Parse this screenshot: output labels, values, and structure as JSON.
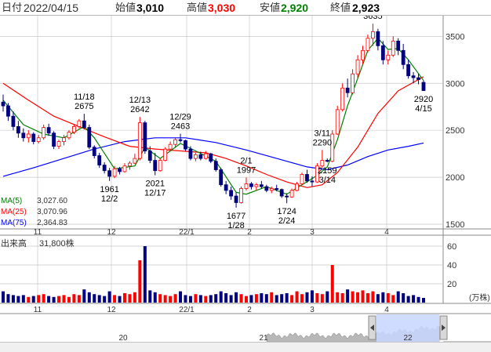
{
  "header": {
    "date_label": "日付",
    "date_value": "2022/04/15",
    "open_label": "始値",
    "open_value": "3,010",
    "high_label": "高値",
    "high_value": "3,030",
    "low_label": "安値",
    "low_value": "2,920",
    "close_label": "終値",
    "close_value": "2,923"
  },
  "colors": {
    "up_candle": "#ff0000",
    "down_candle": "#000080",
    "ma5": "#008000",
    "ma25": "#ff0000",
    "ma75": "#0000ff",
    "volume_up": "#ff0000",
    "volume_down": "#000080",
    "high_value_text": "#ff0000",
    "low_value_text": "#008000",
    "grid": "#c8c8c8",
    "navigator_fill": "#b8b8b8",
    "navigator_window": "#c8d6ff"
  },
  "chart_data": {
    "type": "candlestick",
    "price_axis": {
      "ticks": [
        "1500",
        "2000",
        "2500",
        "3000",
        "3500"
      ],
      "ylim": [
        1450,
        3720
      ]
    },
    "x_axis": {
      "month_labels": [
        "11",
        "12",
        "22/1",
        "2",
        "3",
        "4"
      ]
    },
    "ma_legend": [
      {
        "name": "MA(5)",
        "value": "3,027.60"
      },
      {
        "name": "MA(25)",
        "value": "3,070.96"
      },
      {
        "name": "MA(75)",
        "value": "2,364.83"
      }
    ],
    "annotations": [
      {
        "date": "11/18",
        "value": "2675",
        "position": "above"
      },
      {
        "date": "12/2",
        "value": "1961",
        "position": "below"
      },
      {
        "date": "12/13",
        "value": "2642",
        "position": "above"
      },
      {
        "date": "12/17",
        "value": "2021",
        "position": "below"
      },
      {
        "date": "12/29",
        "value": "2463",
        "position": "above"
      },
      {
        "date": "1/28",
        "value": "1677",
        "position": "below"
      },
      {
        "date": "2/1",
        "value": "1997",
        "position": "above"
      },
      {
        "date": "2/24",
        "value": "1724",
        "position": "below"
      },
      {
        "date": "3/11",
        "value": "2290",
        "position": "above"
      },
      {
        "date": "3/14",
        "value": "2159",
        "position": "below"
      },
      {
        "date": "3/30",
        "value": "3635",
        "position": "above"
      },
      {
        "date": "4/15",
        "value": "2920",
        "position": "below"
      }
    ],
    "candles": [
      {
        "open": 2800,
        "high": 2880,
        "low": 2700,
        "close": 2760
      },
      {
        "open": 2760,
        "high": 2790,
        "low": 2600,
        "close": 2650
      },
      {
        "open": 2650,
        "high": 2700,
        "low": 2500,
        "close": 2540
      },
      {
        "open": 2540,
        "high": 2600,
        "low": 2420,
        "close": 2470
      },
      {
        "open": 2470,
        "high": 2520,
        "low": 2380,
        "close": 2420
      },
      {
        "open": 2420,
        "high": 2500,
        "low": 2370,
        "close": 2460
      },
      {
        "open": 2460,
        "high": 2480,
        "low": 2350,
        "close": 2380
      },
      {
        "open": 2380,
        "high": 2450,
        "low": 2360,
        "close": 2420
      },
      {
        "open": 2420,
        "high": 2560,
        "low": 2400,
        "close": 2530
      },
      {
        "open": 2530,
        "high": 2570,
        "low": 2440,
        "close": 2470
      },
      {
        "open": 2470,
        "high": 2490,
        "low": 2300,
        "close": 2330
      },
      {
        "open": 2330,
        "high": 2400,
        "low": 2300,
        "close": 2380
      },
      {
        "open": 2380,
        "high": 2450,
        "low": 2340,
        "close": 2420
      },
      {
        "open": 2420,
        "high": 2500,
        "low": 2400,
        "close": 2480
      },
      {
        "open": 2480,
        "high": 2560,
        "low": 2460,
        "close": 2540
      },
      {
        "open": 2540,
        "high": 2620,
        "low": 2520,
        "close": 2600
      },
      {
        "open": 2600,
        "high": 2675,
        "low": 2510,
        "close": 2530
      },
      {
        "open": 2530,
        "high": 2560,
        "low": 2300,
        "close": 2320
      },
      {
        "open": 2320,
        "high": 2340,
        "low": 2200,
        "close": 2230
      },
      {
        "open": 2230,
        "high": 2260,
        "low": 2100,
        "close": 2130
      },
      {
        "open": 2130,
        "high": 2160,
        "low": 2040,
        "close": 2070
      },
      {
        "open": 2070,
        "high": 2100,
        "low": 1961,
        "close": 2010
      },
      {
        "open": 2010,
        "high": 2120,
        "low": 1990,
        "close": 2090
      },
      {
        "open": 2090,
        "high": 2110,
        "low": 2030,
        "close": 2060
      },
      {
        "open": 2060,
        "high": 2150,
        "low": 2050,
        "close": 2120
      },
      {
        "open": 2120,
        "high": 2170,
        "low": 2080,
        "close": 2150
      },
      {
        "open": 2150,
        "high": 2250,
        "low": 2140,
        "close": 2200
      },
      {
        "open": 2200,
        "high": 2642,
        "low": 2180,
        "close": 2580
      },
      {
        "open": 2580,
        "high": 2600,
        "low": 2250,
        "close": 2280
      },
      {
        "open": 2280,
        "high": 2330,
        "low": 2150,
        "close": 2180
      },
      {
        "open": 2180,
        "high": 2260,
        "low": 2021,
        "close": 2070
      },
      {
        "open": 2070,
        "high": 2200,
        "low": 2060,
        "close": 2180
      },
      {
        "open": 2180,
        "high": 2320,
        "low": 2170,
        "close": 2300
      },
      {
        "open": 2300,
        "high": 2380,
        "low": 2280,
        "close": 2350
      },
      {
        "open": 2350,
        "high": 2420,
        "low": 2320,
        "close": 2400
      },
      {
        "open": 2400,
        "high": 2463,
        "low": 2370,
        "close": 2390
      },
      {
        "open": 2390,
        "high": 2400,
        "low": 2280,
        "close": 2300
      },
      {
        "open": 2300,
        "high": 2330,
        "low": 2180,
        "close": 2200
      },
      {
        "open": 2200,
        "high": 2260,
        "low": 2170,
        "close": 2240
      },
      {
        "open": 2240,
        "high": 2270,
        "low": 2180,
        "close": 2200
      },
      {
        "open": 2200,
        "high": 2280,
        "low": 2190,
        "close": 2250
      },
      {
        "open": 2250,
        "high": 2260,
        "low": 2150,
        "close": 2170
      },
      {
        "open": 2170,
        "high": 2200,
        "low": 2060,
        "close": 2080
      },
      {
        "open": 2080,
        "high": 2100,
        "low": 1900,
        "close": 1920
      },
      {
        "open": 1920,
        "high": 1960,
        "low": 1820,
        "close": 1860
      },
      {
        "open": 1860,
        "high": 1900,
        "low": 1760,
        "close": 1800
      },
      {
        "open": 1800,
        "high": 1840,
        "low": 1677,
        "close": 1730
      },
      {
        "open": 1730,
        "high": 1900,
        "low": 1720,
        "close": 1880
      },
      {
        "open": 1880,
        "high": 1997,
        "low": 1860,
        "close": 1930
      },
      {
        "open": 1930,
        "high": 1950,
        "low": 1870,
        "close": 1900
      },
      {
        "open": 1900,
        "high": 1940,
        "low": 1860,
        "close": 1920
      },
      {
        "open": 1920,
        "high": 1960,
        "low": 1880,
        "close": 1900
      },
      {
        "open": 1900,
        "high": 1920,
        "low": 1840,
        "close": 1860
      },
      {
        "open": 1860,
        "high": 1900,
        "low": 1830,
        "close": 1880
      },
      {
        "open": 1880,
        "high": 1920,
        "low": 1850,
        "close": 1870
      },
      {
        "open": 1870,
        "high": 1880,
        "low": 1780,
        "close": 1800
      },
      {
        "open": 1800,
        "high": 1830,
        "low": 1724,
        "close": 1790
      },
      {
        "open": 1790,
        "high": 1880,
        "low": 1780,
        "close": 1860
      },
      {
        "open": 1860,
        "high": 1950,
        "low": 1850,
        "close": 1930
      },
      {
        "open": 1930,
        "high": 2050,
        "low": 1920,
        "close": 2030
      },
      {
        "open": 2030,
        "high": 2080,
        "low": 1940,
        "close": 1960
      },
      {
        "open": 1960,
        "high": 2010,
        "low": 1900,
        "close": 1950
      },
      {
        "open": 1950,
        "high": 2150,
        "low": 1940,
        "close": 2120
      },
      {
        "open": 2120,
        "high": 2290,
        "low": 2100,
        "close": 2180
      },
      {
        "open": 2180,
        "high": 2200,
        "low": 2159,
        "close": 2170
      },
      {
        "open": 2170,
        "high": 2500,
        "low": 2160,
        "close": 2460
      },
      {
        "open": 2460,
        "high": 2760,
        "low": 2450,
        "close": 2720
      },
      {
        "open": 2720,
        "high": 3000,
        "low": 2700,
        "close": 2950
      },
      {
        "open": 2950,
        "high": 3050,
        "low": 2850,
        "close": 2900
      },
      {
        "open": 2900,
        "high": 3150,
        "low": 2880,
        "close": 3100
      },
      {
        "open": 3100,
        "high": 3300,
        "low": 3060,
        "close": 3250
      },
      {
        "open": 3250,
        "high": 3400,
        "low": 3200,
        "close": 3350
      },
      {
        "open": 3350,
        "high": 3520,
        "low": 3330,
        "close": 3480
      },
      {
        "open": 3480,
        "high": 3635,
        "low": 3400,
        "close": 3550
      },
      {
        "open": 3550,
        "high": 3580,
        "low": 3350,
        "close": 3400
      },
      {
        "open": 3400,
        "high": 3450,
        "low": 3200,
        "close": 3250
      },
      {
        "open": 3250,
        "high": 3350,
        "low": 3200,
        "close": 3300
      },
      {
        "open": 3300,
        "high": 3500,
        "low": 3280,
        "close": 3450
      },
      {
        "open": 3450,
        "high": 3480,
        "low": 3300,
        "close": 3350
      },
      {
        "open": 3350,
        "high": 3420,
        "low": 3150,
        "close": 3200
      },
      {
        "open": 3200,
        "high": 3250,
        "low": 3050,
        "close": 3080
      },
      {
        "open": 3080,
        "high": 3120,
        "low": 3000,
        "close": 3060
      },
      {
        "open": 3060,
        "high": 3100,
        "low": 2990,
        "close": 3040
      },
      {
        "open": 3010,
        "high": 3030,
        "low": 2920,
        "close": 2923
      }
    ],
    "ma5": [
      {
        "i": 0,
        "v": 2820
      },
      {
        "i": 4,
        "v": 2560
      },
      {
        "i": 8,
        "v": 2460
      },
      {
        "i": 12,
        "v": 2420
      },
      {
        "i": 16,
        "v": 2540
      },
      {
        "i": 18,
        "v": 2420
      },
      {
        "i": 22,
        "v": 2090
      },
      {
        "i": 26,
        "v": 2120
      },
      {
        "i": 28,
        "v": 2320
      },
      {
        "i": 31,
        "v": 2200
      },
      {
        "i": 35,
        "v": 2360
      },
      {
        "i": 38,
        "v": 2280
      },
      {
        "i": 42,
        "v": 2170
      },
      {
        "i": 46,
        "v": 1840
      },
      {
        "i": 48,
        "v": 1820
      },
      {
        "i": 52,
        "v": 1900
      },
      {
        "i": 56,
        "v": 1820
      },
      {
        "i": 59,
        "v": 1920
      },
      {
        "i": 62,
        "v": 2020
      },
      {
        "i": 64,
        "v": 2110
      },
      {
        "i": 66,
        "v": 2400
      },
      {
        "i": 68,
        "v": 2760
      },
      {
        "i": 70,
        "v": 3050
      },
      {
        "i": 72,
        "v": 3350
      },
      {
        "i": 74,
        "v": 3480
      },
      {
        "i": 76,
        "v": 3360
      },
      {
        "i": 78,
        "v": 3370
      },
      {
        "i": 80,
        "v": 3250
      },
      {
        "i": 83,
        "v": 3030
      }
    ],
    "ma25": [
      {
        "i": 0,
        "v": 3000
      },
      {
        "i": 5,
        "v": 2820
      },
      {
        "i": 10,
        "v": 2650
      },
      {
        "i": 15,
        "v": 2540
      },
      {
        "i": 20,
        "v": 2430
      },
      {
        "i": 25,
        "v": 2330
      },
      {
        "i": 30,
        "v": 2300
      },
      {
        "i": 35,
        "v": 2280
      },
      {
        "i": 40,
        "v": 2260
      },
      {
        "i": 44,
        "v": 2200
      },
      {
        "i": 48,
        "v": 2120
      },
      {
        "i": 52,
        "v": 2030
      },
      {
        "i": 56,
        "v": 1950
      },
      {
        "i": 60,
        "v": 1890
      },
      {
        "i": 63,
        "v": 1920
      },
      {
        "i": 66,
        "v": 2050
      },
      {
        "i": 70,
        "v": 2320
      },
      {
        "i": 74,
        "v": 2680
      },
      {
        "i": 78,
        "v": 2920
      },
      {
        "i": 83,
        "v": 3070
      }
    ],
    "ma75": [
      {
        "i": 0,
        "v": 2010
      },
      {
        "i": 6,
        "v": 2100
      },
      {
        "i": 12,
        "v": 2200
      },
      {
        "i": 18,
        "v": 2300
      },
      {
        "i": 24,
        "v": 2380
      },
      {
        "i": 30,
        "v": 2420
      },
      {
        "i": 36,
        "v": 2420
      },
      {
        "i": 42,
        "v": 2370
      },
      {
        "i": 48,
        "v": 2290
      },
      {
        "i": 54,
        "v": 2200
      },
      {
        "i": 60,
        "v": 2110
      },
      {
        "i": 64,
        "v": 2080
      },
      {
        "i": 68,
        "v": 2130
      },
      {
        "i": 72,
        "v": 2220
      },
      {
        "i": 76,
        "v": 2290
      },
      {
        "i": 80,
        "v": 2330
      },
      {
        "i": 83,
        "v": 2365
      }
    ],
    "volume_panel": {
      "label": "出来高",
      "current_volume": "31,800株",
      "ticks": [
        "20",
        "40",
        "60"
      ],
      "unit": "(万株)",
      "ylim": [
        0,
        70
      ],
      "values": [
        12,
        9,
        8,
        7,
        8,
        6,
        7,
        8,
        9,
        7,
        6,
        7,
        8,
        6,
        9,
        8,
        14,
        11,
        9,
        8,
        7,
        12,
        8,
        7,
        10,
        9,
        11,
        45,
        60,
        13,
        11,
        9,
        8,
        7,
        9,
        12,
        8,
        7,
        9,
        8,
        7,
        8,
        9,
        12,
        10,
        8,
        11,
        9,
        7,
        8,
        9,
        10,
        9,
        11,
        8,
        9,
        10,
        8,
        12,
        9,
        11,
        13,
        10,
        9,
        12,
        40,
        11,
        10,
        14,
        12,
        11,
        13,
        10,
        12,
        9,
        11,
        10,
        8,
        12,
        10,
        7,
        8,
        6,
        5
      ]
    },
    "navigator": {
      "labels": [
        "20",
        "21",
        "22"
      ]
    }
  }
}
